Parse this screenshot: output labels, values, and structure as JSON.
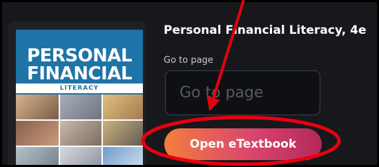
{
  "cover": {
    "title_line1": "PERSONAL",
    "title_line2": "FINANCIAL",
    "subtitle": "LITERACY"
  },
  "book": {
    "title": "Personal Financial Literacy, 4e"
  },
  "goto": {
    "label": "Go to page",
    "placeholder": "Go to page"
  },
  "open_button": {
    "label": "Open eTextbook"
  },
  "colors": {
    "panel_bg": "#17181b",
    "button_start": "#f37e3d",
    "button_end": "#b3285a",
    "annotation_red": "#e8000f"
  }
}
